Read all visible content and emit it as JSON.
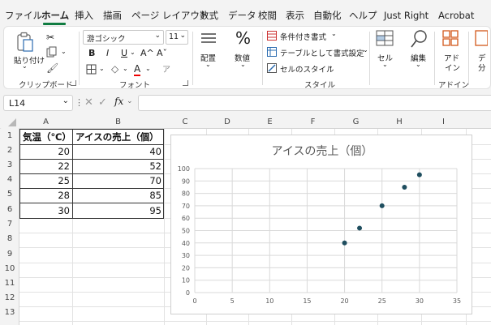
{
  "menu_tabs": [
    "ファイル",
    "ホーム",
    "挿入",
    "描画",
    "ページ レイアウト",
    "数式",
    "データ",
    "校閲",
    "表示",
    "自動化",
    "ヘルプ",
    "Just Right",
    "Acrobat"
  ],
  "active_tab": "ホーム",
  "ribbon": {
    "clipboard": {
      "paste": "貼り付け",
      "label": "クリップボード"
    },
    "font": {
      "name": "游ゴシック",
      "size": "11",
      "label": "フォント",
      "bold": "B",
      "italic": "I",
      "underline": "U",
      "grow": "A^",
      "shrink": "Aˇ",
      "color_a": "A"
    },
    "alignment": {
      "label": "配置"
    },
    "number": {
      "symbol": "%",
      "label": "数値"
    },
    "styles": {
      "conditional": "条件付き書式",
      "table": "テーブルとして書式設定",
      "cell_styles": "セルのスタイル",
      "label": "スタイル"
    },
    "cells": {
      "label": "セル"
    },
    "editing": {
      "label": "編集"
    },
    "addins": {
      "label": "アド\nイン",
      "label1": "アド",
      "label2": "イン",
      "group": "アドイン"
    },
    "extra": {
      "label1": "デ",
      "label2": "分"
    }
  },
  "formula_bar": {
    "name_box": "L14",
    "fx": "fx",
    "formula": ""
  },
  "columns": [
    "A",
    "B",
    "C",
    "D",
    "E",
    "F",
    "G",
    "H",
    "I"
  ],
  "rows": [
    "1",
    "2",
    "3",
    "4",
    "5",
    "6",
    "7",
    "8",
    "9",
    "10",
    "11",
    "12",
    "13"
  ],
  "table": {
    "headers": [
      "気温（℃）",
      "アイスの売上（個）"
    ],
    "rows": [
      [
        20,
        40
      ],
      [
        22,
        52
      ],
      [
        25,
        70
      ],
      [
        28,
        85
      ],
      [
        30,
        95
      ]
    ]
  },
  "chart_data": {
    "type": "scatter",
    "title": "アイスの売上（個）",
    "x": [
      20,
      22,
      25,
      28,
      30
    ],
    "y": [
      40,
      52,
      70,
      85,
      95
    ],
    "xlim": [
      0,
      35
    ],
    "ylim": [
      0,
      100
    ],
    "xticks": [
      0,
      5,
      10,
      15,
      20,
      25,
      30,
      35
    ],
    "yticks": [
      0,
      10,
      20,
      30,
      40,
      50,
      60,
      70,
      80,
      90,
      100
    ],
    "grid": true,
    "marker_color": "#1f4e5f"
  }
}
